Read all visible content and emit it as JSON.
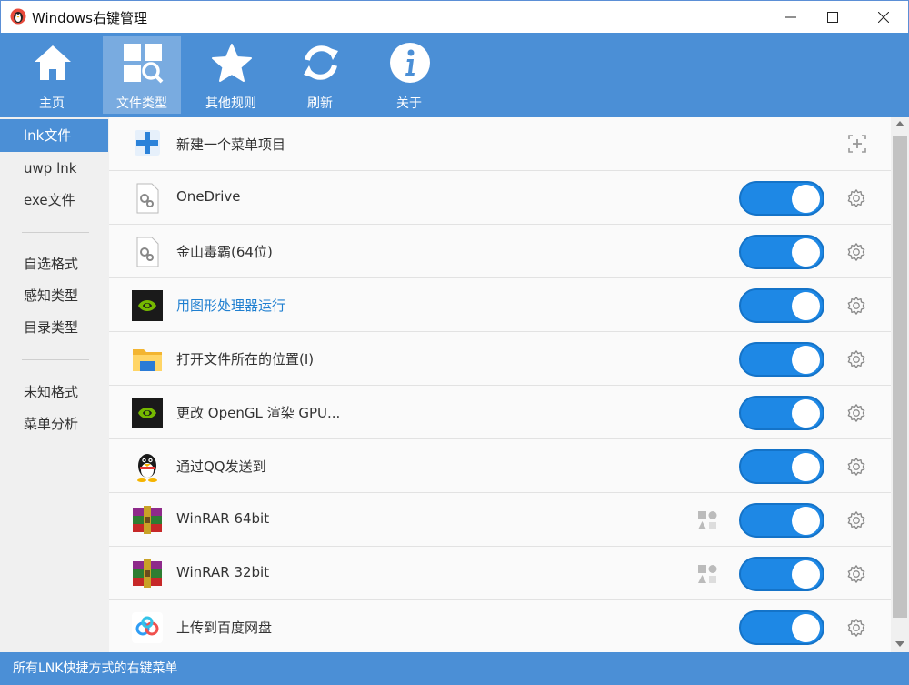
{
  "window": {
    "title": "Windows右键管理",
    "minimize": "─",
    "maximize": "☐",
    "close": "✕"
  },
  "toolbar": [
    {
      "label": "主页",
      "icon": "home-icon"
    },
    {
      "label": "文件类型",
      "icon": "file-type-search-icon",
      "active": true
    },
    {
      "label": "其他规则",
      "icon": "star-icon"
    },
    {
      "label": "刷新",
      "icon": "refresh-icon"
    },
    {
      "label": "关于",
      "icon": "info-icon"
    }
  ],
  "sidebar": {
    "groups": [
      [
        {
          "label": "lnk文件",
          "active": true
        },
        {
          "label": "uwp lnk"
        },
        {
          "label": "exe文件"
        }
      ],
      [
        {
          "label": "自选格式"
        },
        {
          "label": "感知类型"
        },
        {
          "label": "目录类型"
        }
      ],
      [
        {
          "label": "未知格式"
        },
        {
          "label": "菜单分析"
        }
      ]
    ]
  },
  "list": {
    "new_item": {
      "label": "新建一个菜单项目",
      "icon": "plus-icon",
      "action_icon": "add-box-icon"
    },
    "items": [
      {
        "label": "OneDrive",
        "icon": "settings-file-icon",
        "enabled": true
      },
      {
        "label": "金山毒霸(64位)",
        "icon": "settings-file-icon",
        "enabled": true
      },
      {
        "label": "用图形处理器运行",
        "icon": "nvidia-icon",
        "enabled": true,
        "highlight": true
      },
      {
        "label": "打开文件所在的位置(I)",
        "icon": "folder-icon",
        "enabled": true
      },
      {
        "label": "更改 OpenGL 渲染 GPU...",
        "icon": "nvidia-icon",
        "enabled": true
      },
      {
        "label": "通过QQ发送到",
        "icon": "qq-penguin-icon",
        "enabled": true
      },
      {
        "label": "WinRAR 64bit",
        "icon": "winrar-icon",
        "enabled": true,
        "shapes": true
      },
      {
        "label": "WinRAR 32bit",
        "icon": "winrar-icon",
        "enabled": true,
        "shapes": true
      },
      {
        "label": "上传到百度网盘",
        "icon": "baidu-netdisk-icon",
        "enabled": true
      }
    ]
  },
  "status": {
    "text": "所有LNK快捷方式的右键菜单"
  },
  "colors": {
    "accent": "#4b8fd6",
    "toggle_on": "#1e88e5",
    "link": "#1f7fd0"
  }
}
